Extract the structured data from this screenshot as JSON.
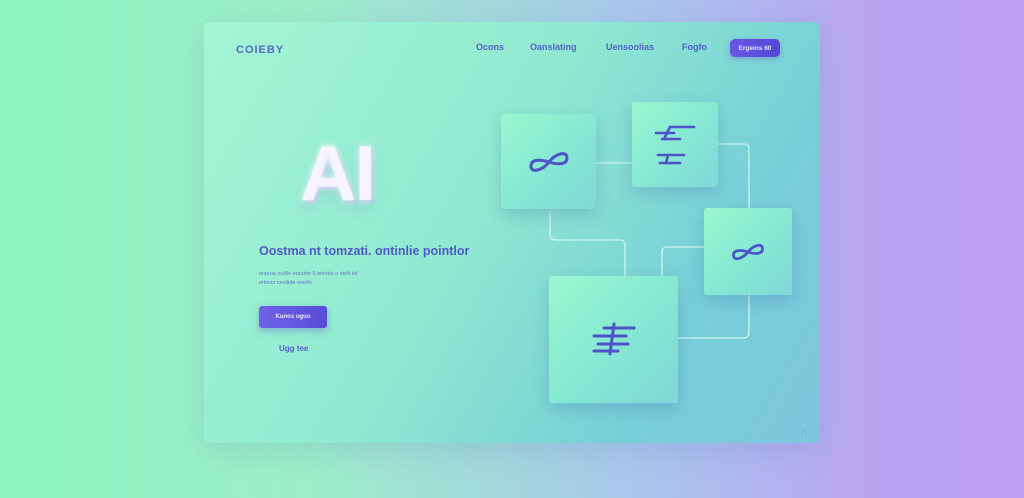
{
  "brand": {
    "logo": "COIEBY"
  },
  "nav": {
    "items": [
      {
        "label": "Ocons"
      },
      {
        "label": "Oanslating"
      },
      {
        "label": "Uensoolias"
      },
      {
        "label": "Fogfo"
      }
    ],
    "cta_label": "Ergeins 60"
  },
  "hero": {
    "big_text": "AI",
    "headline": "Oostma nt tomzati. ontinlie pointlor",
    "sub_lines": [
      "erseoe ourtle erstutte 5 oninbe o etelt tol",
      "erlimcr sesilide oneillc"
    ],
    "cta_label": "Kunos uguo",
    "link_label": "Ugg tee"
  },
  "colors": {
    "accent": "#5a4bd6",
    "text_primary": "#5359c3",
    "icon": "#4f53c9",
    "connector": "#c9f2ea"
  },
  "tiles": [
    {
      "icon": "infinity-icon"
    },
    {
      "icon": "sliders-icon"
    },
    {
      "icon": "infinity-icon"
    },
    {
      "icon": "sliders-icon"
    }
  ]
}
